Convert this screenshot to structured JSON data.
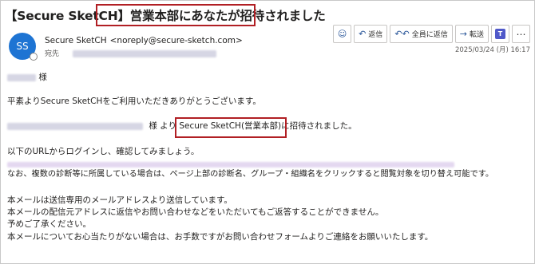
{
  "message": {
    "subject_prefix": "【Secure SketCH】",
    "subject_highlight": "営業本部にあなたが招待されました",
    "avatar_initials": "SS",
    "sender_name": "Secure SketCH",
    "sender_email": "<noreply@secure-sketch.com>",
    "to_label": "宛先",
    "date": "2025/03/24 (月) 16:17"
  },
  "toolbar": {
    "reply_label": "返信",
    "reply_all_label": "全員に返信",
    "forward_label": "転送",
    "teams_label": "T"
  },
  "body": {
    "greeting_suffix": "様",
    "line1": "平素よりSecure SketCHをご利用いただきありがとうございます。",
    "invite_mid": "様 より",
    "invite_highlight": "Secure SketCH(営業本部)",
    "invite_end": "に招待されました。",
    "line3": "以下のURLからログインし、確認してみましょう。",
    "line4": "なお、複数の診断等に所属している場合は、ページ上部の診断名、グループ・組織名をクリックすると閲覧対象を切り替え可能です。",
    "notice1": "本メールは送信専用のメールアドレスより送信しています。",
    "notice2": "本メールの配信元アドレスに返信やお問い合わせなどをいただいてもご返答することができません。",
    "notice3": "予めご了承ください。",
    "notice4": "本メールについてお心当たりがない場合は、お手数ですがお問い合わせフォームよりご連絡をお願いいたします。"
  },
  "colors": {
    "accent": "#1e74d3",
    "highlight_border": "#b11f24"
  },
  "icons": [
    "smiley-icon",
    "reply-icon",
    "reply-all-icon",
    "forward-icon",
    "teams-icon",
    "more-icon"
  ]
}
